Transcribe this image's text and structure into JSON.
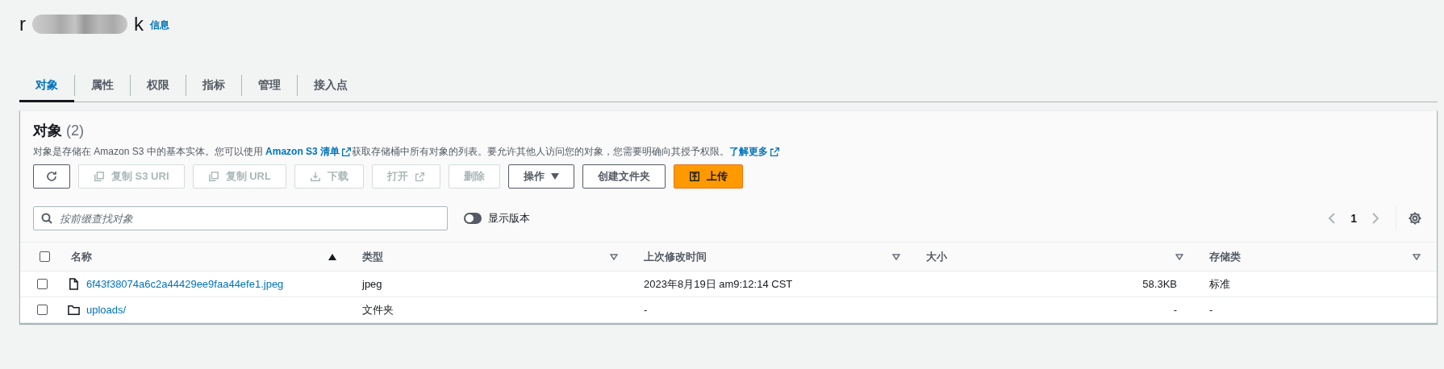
{
  "bucket": {
    "title_start": "r",
    "title_end": "k",
    "title_redacted": true,
    "info_link": "信息"
  },
  "tabs": [
    {
      "label": "对象",
      "selected": true
    },
    {
      "label": "属性",
      "selected": false
    },
    {
      "label": "权限",
      "selected": false
    },
    {
      "label": "指标",
      "selected": false
    },
    {
      "label": "管理",
      "selected": false
    },
    {
      "label": "接入点",
      "selected": false
    }
  ],
  "objects_panel": {
    "heading": "对象",
    "count": "(2)",
    "description": {
      "text_before": "对象是存储在 Amazon S3 中的基本实体。您可以使用",
      "link1": "Amazon S3 清单",
      "text_middle": "获取存储桶中所有对象的列表。要允许其他人访问您的对象，您需要明确向其授予权限。",
      "link2": "了解更多"
    },
    "buttons": [
      {
        "kind": "icon",
        "disabled": false
      },
      {
        "kind": "normal",
        "label": "复制 S3 URI",
        "disabled": true
      },
      {
        "kind": "normal",
        "label": "复制 URL",
        "disabled": true
      },
      {
        "kind": "normal",
        "label": "下载",
        "disabled": true
      },
      {
        "kind": "normal",
        "label": "打开",
        "disabled": true
      },
      {
        "kind": "normal",
        "label": "删除",
        "disabled": true
      },
      {
        "kind": "dropdown",
        "label": "操作",
        "disabled": false
      },
      {
        "kind": "normal",
        "label": "创建文件夹",
        "disabled": false
      },
      {
        "kind": "primary",
        "label": "上传",
        "disabled": false
      }
    ],
    "search": {
      "placeholder": "按前缀查找对象"
    },
    "show_versions": {
      "label": "显示版本",
      "on": false
    },
    "pagination": {
      "page": "1"
    },
    "table": {
      "select_all_checked": false,
      "columns": [
        {
          "label": "名称",
          "sorted": true
        },
        {
          "label": "类型",
          "sorted": false
        },
        {
          "label": "上次修改时间",
          "sorted": false
        },
        {
          "label": "大小",
          "sorted": false
        },
        {
          "label": "存储类",
          "sorted": false
        }
      ],
      "rows": [
        {
          "kind": "file",
          "checked": false,
          "name": "6f43f38074a6c2a44429ee9faa44efe1.jpeg",
          "type": "jpeg",
          "modified": "2023年8月19日 am9:12:14 CST",
          "size": "58.3KB",
          "storage_class": "标准"
        },
        {
          "kind": "folder",
          "checked": false,
          "name": "uploads/",
          "type": "文件夹",
          "modified": "-",
          "size": "-",
          "storage_class": "-"
        }
      ]
    }
  }
}
